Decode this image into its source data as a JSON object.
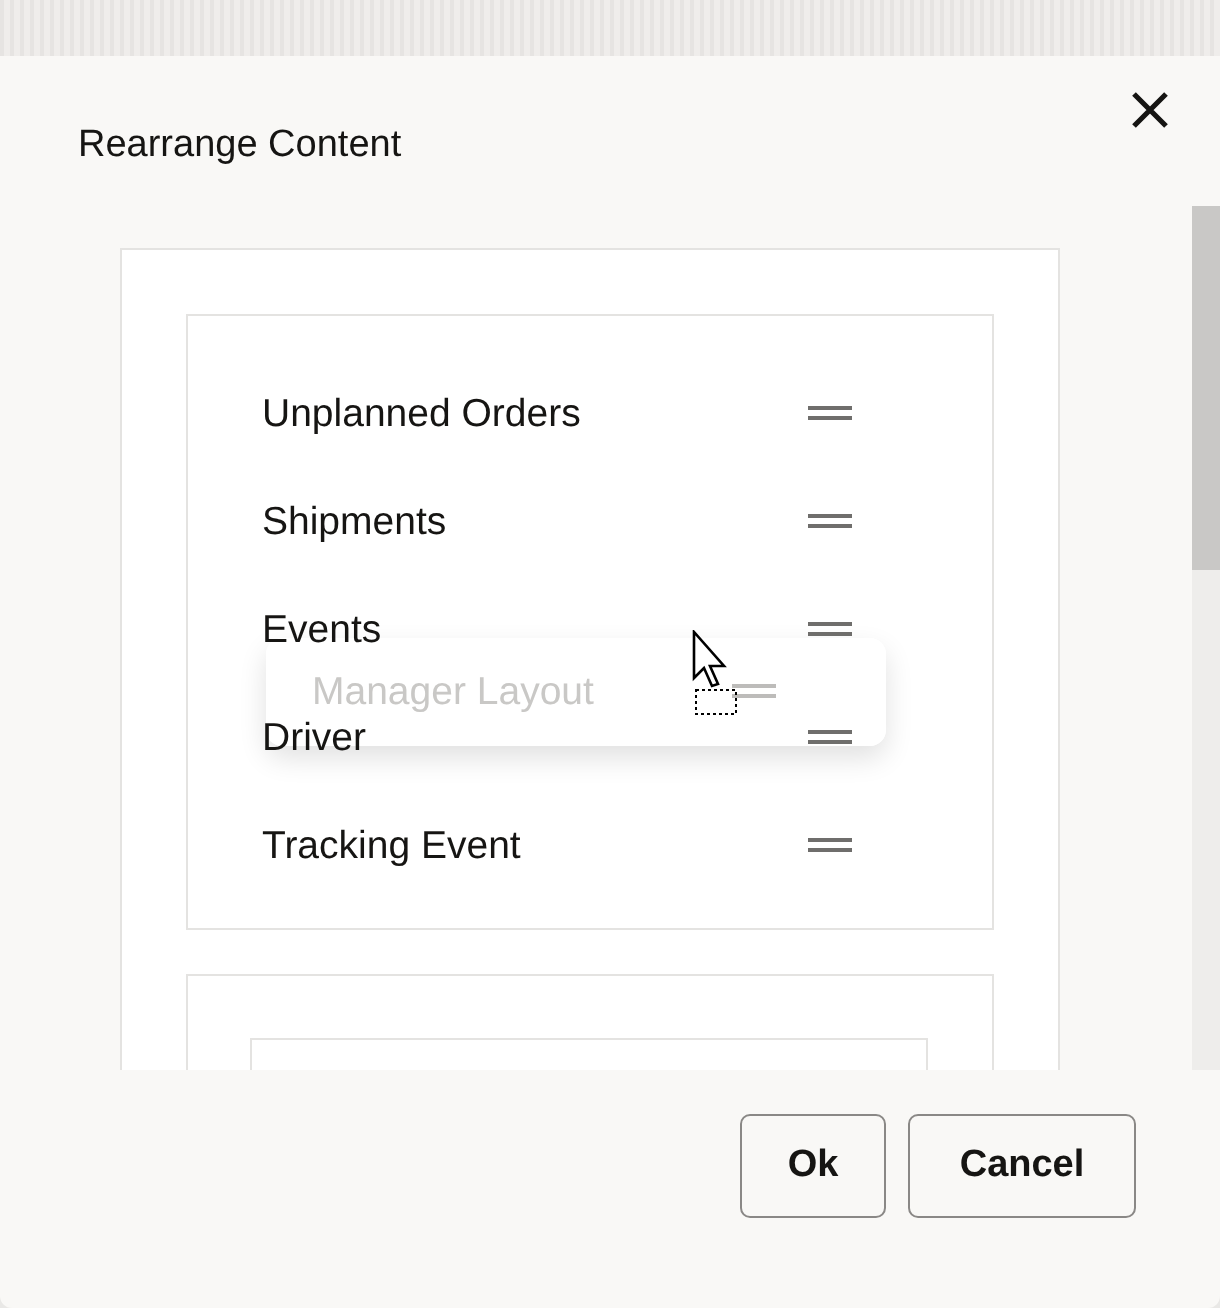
{
  "dialog": {
    "title": "Rearrange Content"
  },
  "items": [
    {
      "label": "Unplanned Orders"
    },
    {
      "label": "Shipments"
    },
    {
      "label": "Events"
    },
    {
      "label": "Driver"
    },
    {
      "label": "Tracking Event"
    }
  ],
  "drag_ghost": {
    "label": "Manager Layout"
  },
  "buttons": [
    {
      "label": "Ok"
    },
    {
      "label": "Cancel"
    }
  ]
}
